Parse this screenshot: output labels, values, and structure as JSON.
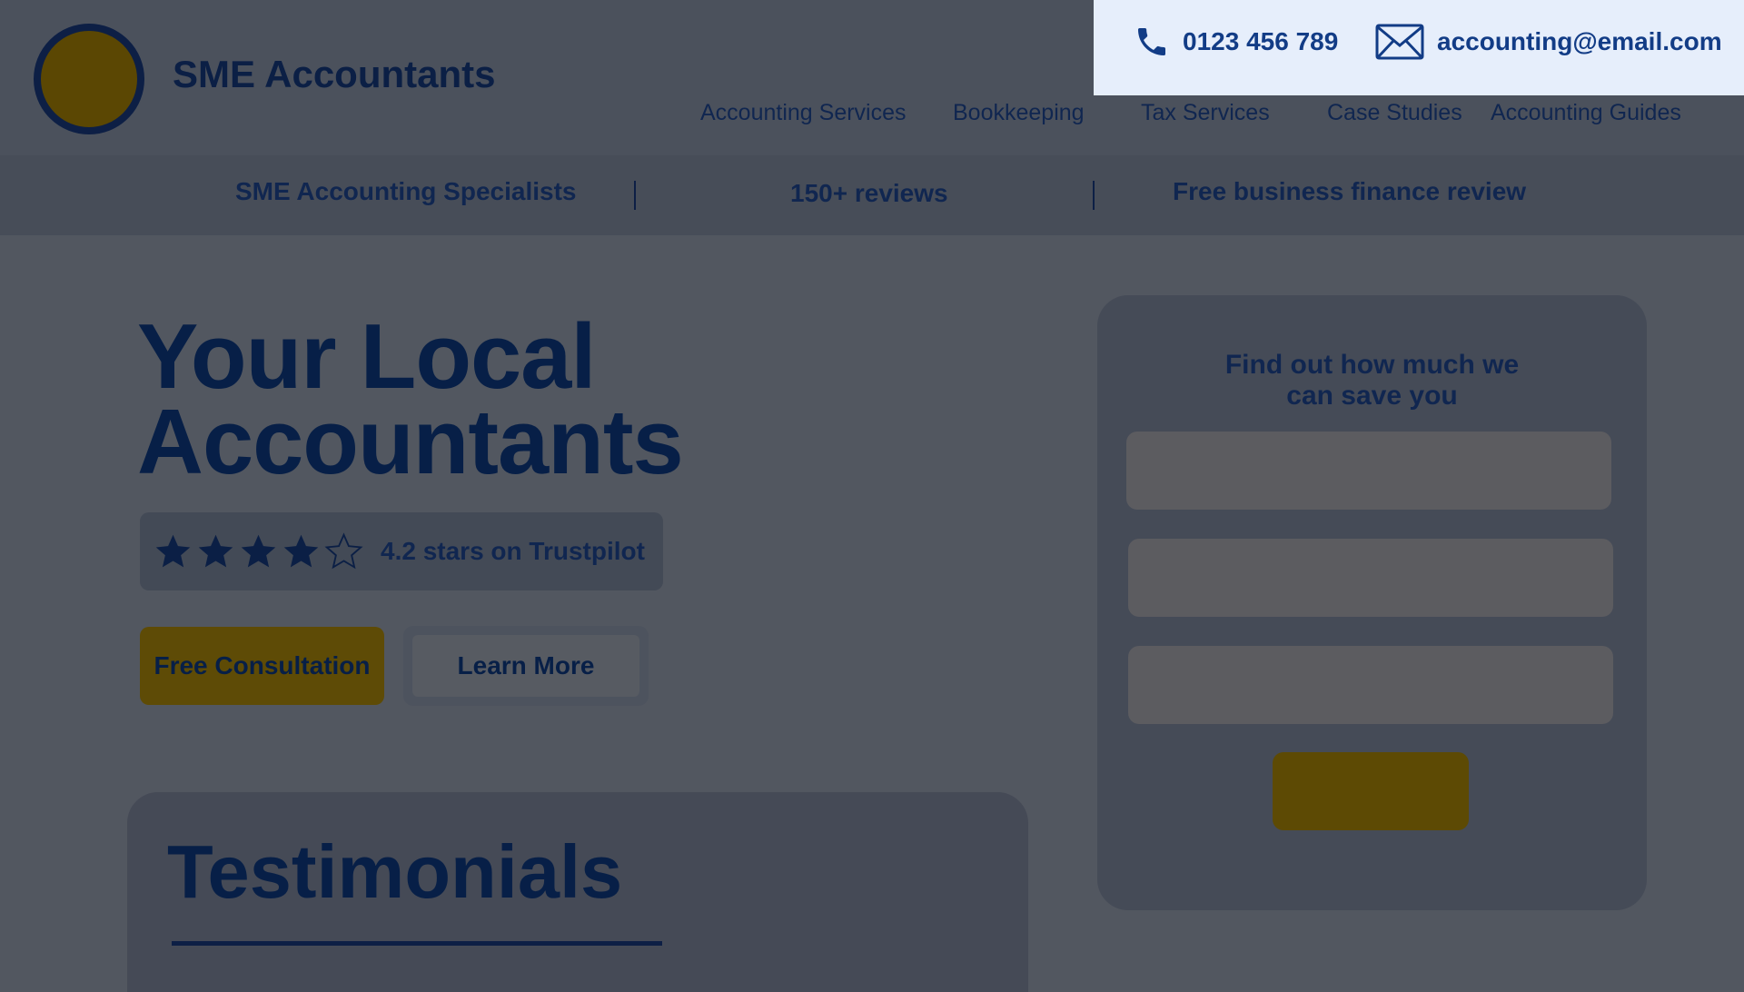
{
  "brand": {
    "name": "SME Accountants"
  },
  "contact": {
    "phone": "0123 456 789",
    "email": "accounting@email.com"
  },
  "nav": {
    "items": [
      "Accounting Services",
      "Bookkeeping",
      "Tax Services",
      "Case Studies",
      "Accounting Guides"
    ]
  },
  "trust_bar": {
    "items": [
      "SME Accounting Specialists",
      "150+ reviews",
      "Free business finance review"
    ]
  },
  "hero": {
    "title_line1": "Your Local",
    "title_line2": "Accountants",
    "rating_value": 4.2,
    "rating_max": 5,
    "rating_text": "4.2 stars on Trustpilot",
    "primary_button": "Free Consultation",
    "secondary_button": "Learn More"
  },
  "testimonials": {
    "title": "Testimonials"
  },
  "form": {
    "title_line1": "Find out how much we",
    "title_line2": "can save you",
    "fields": [
      {
        "value": "",
        "placeholder": ""
      },
      {
        "value": "",
        "placeholder": ""
      },
      {
        "value": "",
        "placeholder": ""
      }
    ],
    "submit_label": ""
  },
  "colors": {
    "header_bg": "#4b515c",
    "contact_bg": "#e6eefb",
    "navy": "#0b1f45",
    "contact_text": "#123c86",
    "gold": "#5e4b06",
    "page_bg": "#525760",
    "card_bg": "#454b57"
  },
  "icons": {
    "phone": "phone-icon",
    "email": "envelope-icon",
    "logo": "logo-circle",
    "star": "star-icon"
  }
}
